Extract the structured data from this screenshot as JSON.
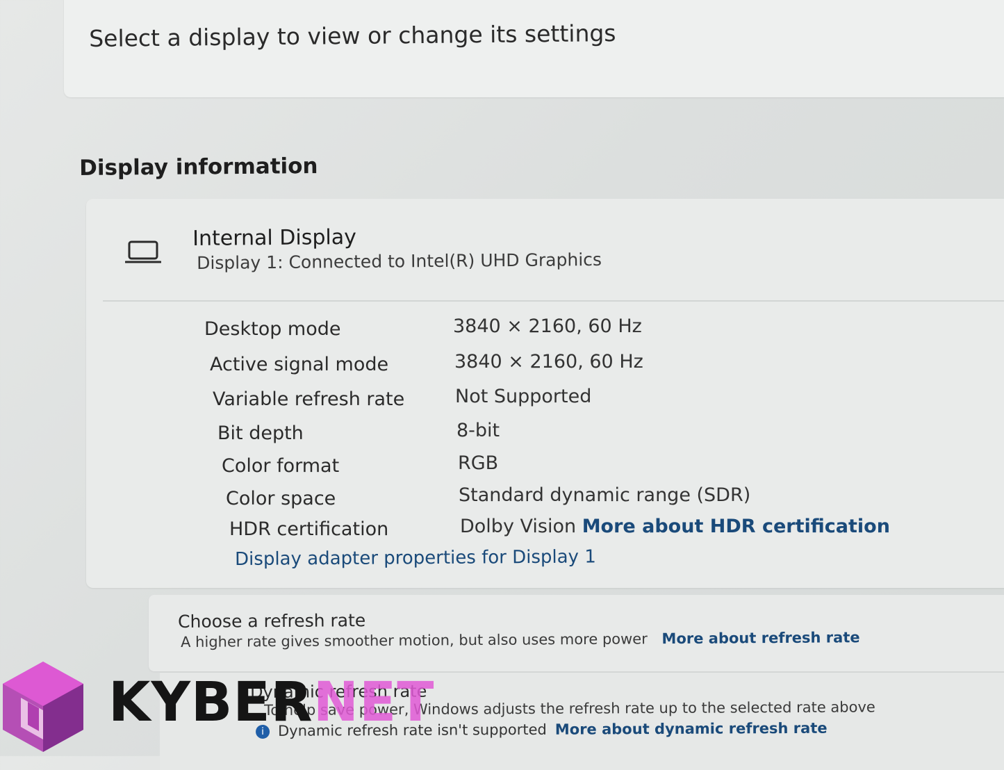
{
  "top_card": {
    "text": "Select a display to view or change its settings"
  },
  "section": {
    "title": "Display information"
  },
  "display": {
    "name": "Internal Display",
    "subtitle": "Display 1: Connected to Intel(R) UHD Graphics",
    "icon": "laptop-icon"
  },
  "info_rows": [
    {
      "label": "Desktop mode",
      "value": "3840 × 2160, 60 Hz"
    },
    {
      "label": "Active signal mode",
      "value": "3840 × 2160, 60 Hz"
    },
    {
      "label": "Variable refresh rate",
      "value": "Not Supported"
    },
    {
      "label": "Bit depth",
      "value": "8-bit"
    },
    {
      "label": "Color format",
      "value": "RGB"
    },
    {
      "label": "Color space",
      "value": "Standard dynamic range (SDR)"
    },
    {
      "label": "HDR certification",
      "value": "Dolby Vision",
      "link": "More about HDR certification"
    }
  ],
  "adapter_link": "Display adapter properties for Display 1",
  "refresh_rate": {
    "title": "Choose a refresh rate",
    "description": "A higher rate gives smoother motion, but also uses more power",
    "link": "More about refresh rate"
  },
  "dynamic_refresh": {
    "title": "Dynamic refresh rate",
    "description": "To help save power, Windows adjusts the refresh rate up to the selected rate above",
    "status": "Dynamic refresh rate isn't supported",
    "link": "More about dynamic refresh rate",
    "icon": "info-icon"
  },
  "watermark": {
    "part1": "KYBER",
    "part2": "NET"
  },
  "colors": {
    "link": "#1a4a7a",
    "accent_magenta": "#e15ad6",
    "info_blue": "#1f5ea8"
  }
}
